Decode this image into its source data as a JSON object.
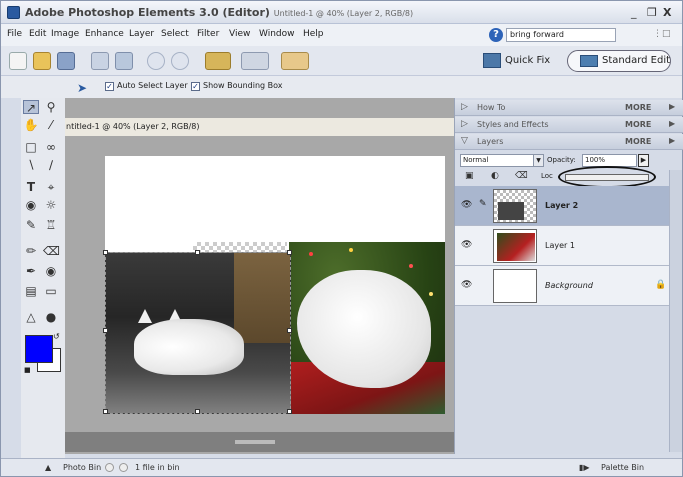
{
  "window": {
    "app_title": "Adobe Photoshop Elements 3.0 (Editor)",
    "doc_title": "Untitled-1 @ 40% (Layer 2, RGB/8)",
    "minimize": "_",
    "restore": "❒",
    "close": "X"
  },
  "menu": {
    "items": [
      "File",
      "Edit",
      "Image",
      "Enhance",
      "Layer",
      "Select",
      "Filter",
      "View",
      "Window",
      "Help"
    ],
    "help_search_value": "bring forward",
    "help_icon": "?"
  },
  "shortcuts": {
    "quick_fix_label": "Quick Fix",
    "standard_edit_label": "Standard Edit"
  },
  "options": {
    "auto_select_label": "Auto Select Layer",
    "show_bounding_label": "Show Bounding Box",
    "check_mark": "✓"
  },
  "toolbox": {
    "tools": [
      "move",
      "zoom",
      "hand",
      "eyedropper",
      "marquee",
      "lasso",
      "magic-wand",
      "selection-brush",
      "type",
      "crop",
      "cookie-cutter",
      "straighten",
      "red-eye",
      "healing",
      "clone-stamp",
      "pencil",
      "eraser",
      "brush",
      "paint-bucket",
      "gradient",
      "shape",
      "blur",
      "sponge"
    ],
    "foreground_color": "#0000ff",
    "background_color": "#ffffff"
  },
  "document": {
    "tab_title": "ntitled-1 @ 40% (Layer 2, RGB/8)"
  },
  "palette": {
    "how_to": "How To",
    "styles_effects": "Styles and Effects",
    "layers": "Layers",
    "more": "MORE",
    "blend_mode": "Normal",
    "opacity_label": "Opacity:",
    "opacity_value": "100%",
    "lock_label": "Loc",
    "layers_list": [
      {
        "name": "Layer 2",
        "selected": true
      },
      {
        "name": "Layer 1",
        "selected": false
      },
      {
        "name": "Background",
        "selected": false
      }
    ]
  },
  "status": {
    "photo_bin_label": "Photo Bin",
    "files_in_bin": "1 file in bin",
    "palette_bin_label": "Palette Bin"
  },
  "colors": {
    "accent": "#2a5aa0",
    "selected_layer": "#a9b6ce"
  }
}
